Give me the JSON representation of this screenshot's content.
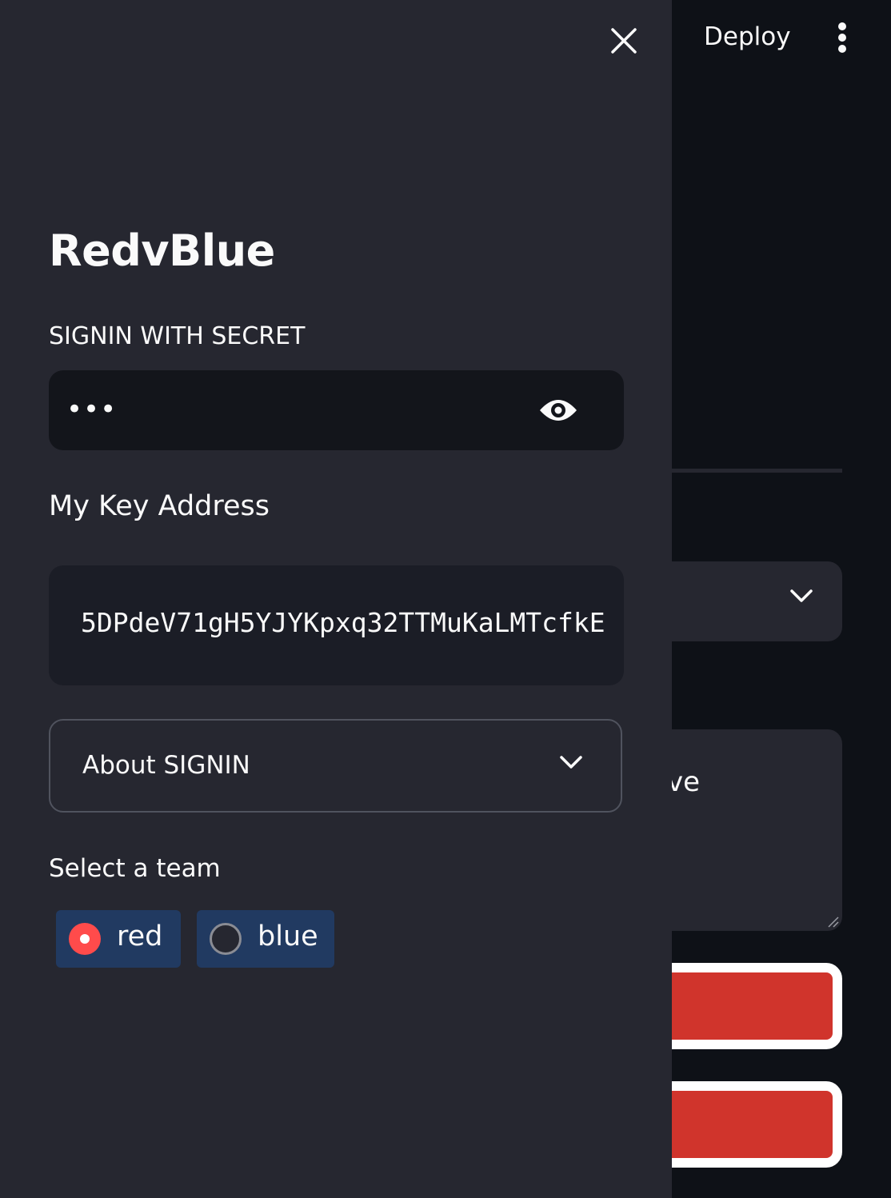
{
  "header": {
    "deploy_label": "Deploy"
  },
  "sidebar": {
    "title": "RedvBlue",
    "secret_label": "SIGNIN WITH SECRET",
    "secret_value": "•••",
    "key_heading": "My Key Address",
    "key_address": "5DPdeV71gH5YJYKpxq32TTMuKaLMTcfkE",
    "expander_label": "About SIGNIN",
    "team_label": "Select a team",
    "team_options": [
      "red",
      "blue"
    ],
    "team_selected": "red"
  },
  "main": {
    "textarea_visible_text": "ve"
  },
  "colors": {
    "background": "#0e1117",
    "sidebar": "#262730",
    "accent": "#ff4b4b",
    "button_red": "#d0342c",
    "radio_bg": "#213a61"
  },
  "icons": [
    "close-icon",
    "kebab-menu-icon",
    "eye-icon",
    "chevron-down-icon",
    "resize-grip-icon",
    "radio-selected-icon",
    "radio-unselected-icon"
  ]
}
